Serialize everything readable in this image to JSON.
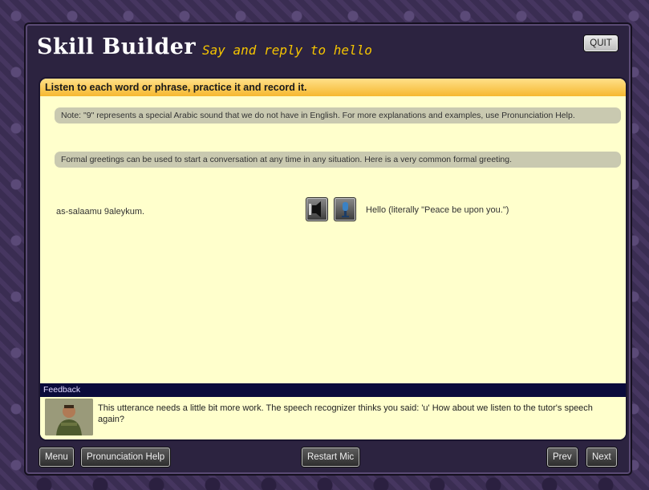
{
  "header": {
    "title": "Skill Builder",
    "subtitle": "Say and reply to hello",
    "quit_label": "QUIT"
  },
  "panel": {
    "instruction": "Listen to each word or phrase, practice it and record it.",
    "notes": [
      "Note: \"9\" represents a special Arabic sound that we do not have in English. For more explanations and examples, use Pronunciation Help.",
      "Formal greetings can be used to start a conversation at any time in any situation. Here is a very common formal greeting."
    ],
    "phrase": {
      "transliteration": "as-salaamu 9aleykum.",
      "translation": "Hello (literally \"Peace be upon you.\")"
    },
    "icons": [
      "speaker-icon",
      "microphone-icon"
    ]
  },
  "feedback": {
    "label": "Feedback",
    "message": "This utterance needs a little bit more work. The speech recognizer thinks you said: 'u' How about we listen to the tutor's speech again?"
  },
  "footer": {
    "menu_label": "Menu",
    "pronunciation_label": "Pronunciation Help",
    "restart_mic_label": "Restart Mic",
    "prev_label": "Prev",
    "next_label": "Next"
  }
}
